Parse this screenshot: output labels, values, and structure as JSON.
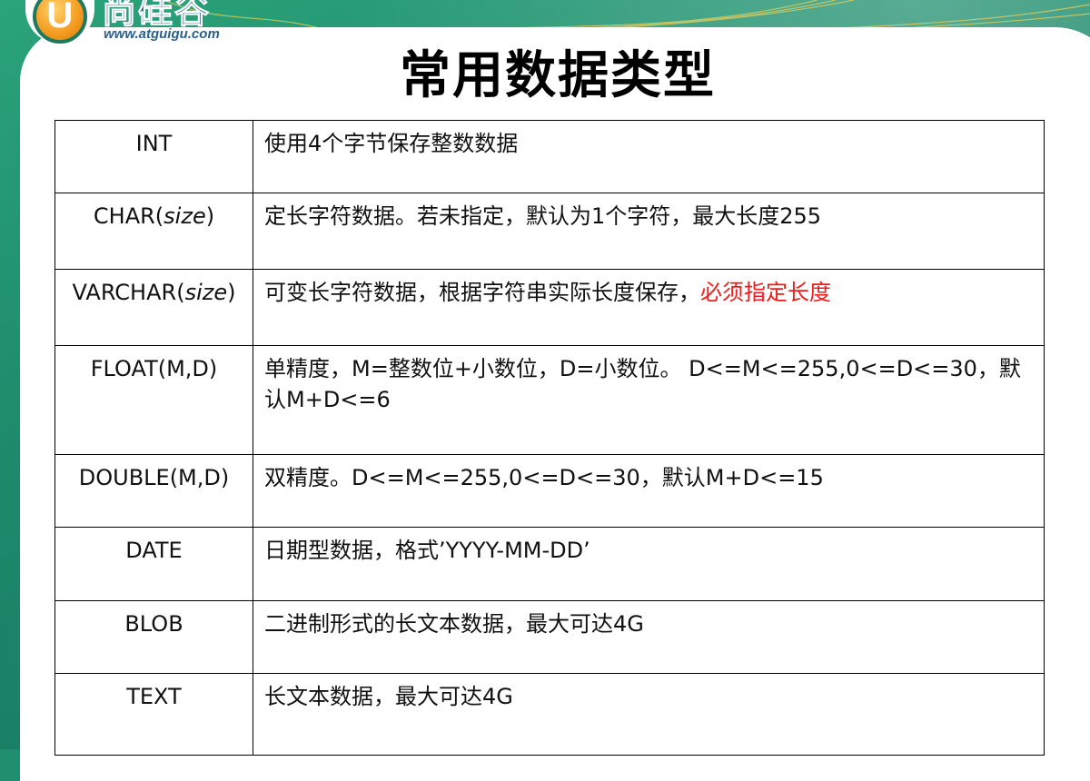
{
  "logo": {
    "letter": "U",
    "name": "尚硅谷",
    "url": "www.atguigu.com"
  },
  "title": "常用数据类型",
  "colors": {
    "highlight": "#ee1c1c",
    "background_green": "#1e8a6b",
    "logo_orange": "#f39a1f"
  },
  "rows": [
    {
      "type_name": "INT",
      "type_arg": "",
      "type_suffix": "",
      "desc": "使用4个字节保存整数数据",
      "desc_highlight": ""
    },
    {
      "type_name": "CHAR(",
      "type_arg": "size",
      "type_suffix": ")",
      "desc": "定长字符数据。若未指定，默认为1个字符，最大长度255",
      "desc_highlight": ""
    },
    {
      "type_name": "VARCHAR(",
      "type_arg": "size",
      "type_suffix": ")",
      "desc": "可变长字符数据，根据字符串实际长度保存，",
      "desc_highlight": "必须指定长度"
    },
    {
      "type_name": "FLOAT(M,D)",
      "type_arg": "",
      "type_suffix": "",
      "desc": "单精度，M=整数位+小数位，D=小数位。 D<=M<=255,0<=D<=30，默认M+D<=6",
      "desc_highlight": ""
    },
    {
      "type_name": "DOUBLE(M,D)",
      "type_arg": "",
      "type_suffix": "",
      "desc": "双精度。D<=M<=255,0<=D<=30，默认M+D<=15",
      "desc_highlight": ""
    },
    {
      "type_name": "DATE",
      "type_arg": "",
      "type_suffix": "",
      "desc": "日期型数据，格式’YYYY-MM-DD’",
      "desc_highlight": ""
    },
    {
      "type_name": "BLOB",
      "type_arg": "",
      "type_suffix": "",
      "desc": "二进制形式的长文本数据，最大可达4G",
      "desc_highlight": ""
    },
    {
      "type_name": "TEXT",
      "type_arg": "",
      "type_suffix": "",
      "desc": "长文本数据，最大可达4G",
      "desc_highlight": ""
    }
  ]
}
